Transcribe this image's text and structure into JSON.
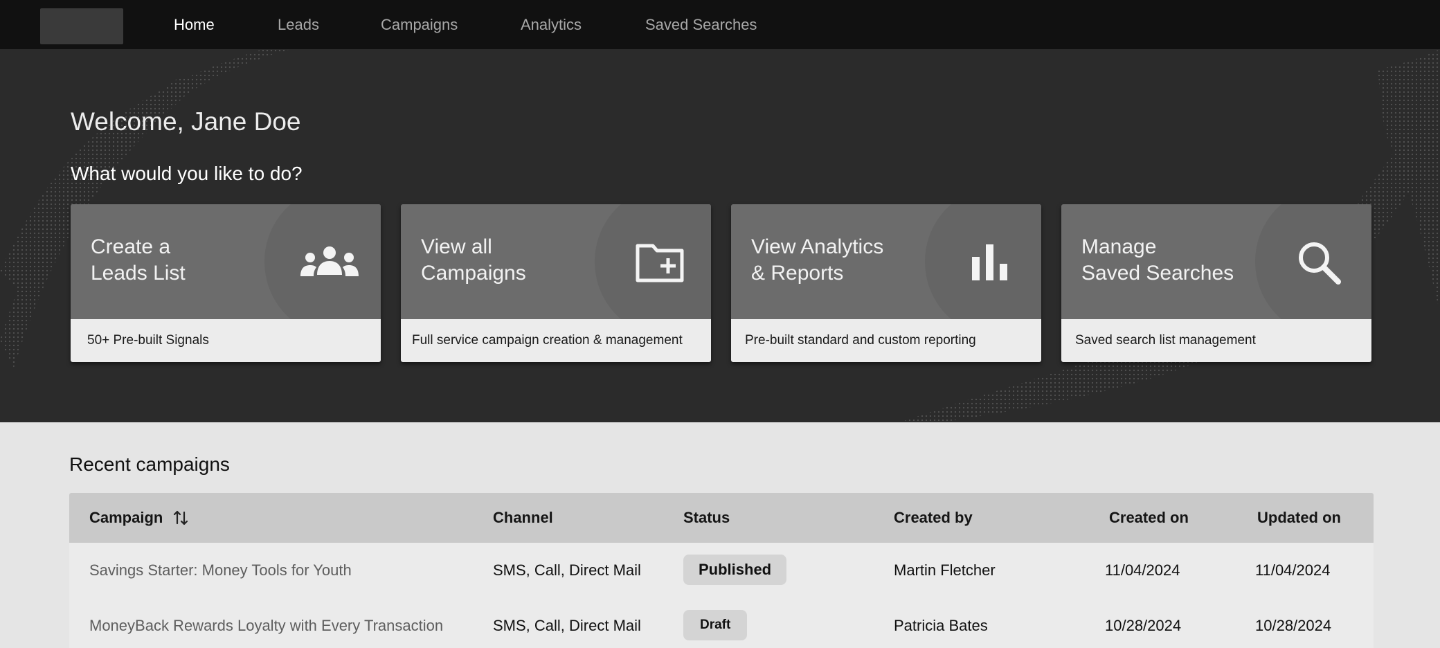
{
  "nav": {
    "items": [
      {
        "label": "Home",
        "active": true
      },
      {
        "label": "Leads",
        "active": false
      },
      {
        "label": "Campaigns",
        "active": false
      },
      {
        "label": "Analytics",
        "active": false
      },
      {
        "label": "Saved Searches",
        "active": false
      }
    ]
  },
  "hero": {
    "welcome": "Welcome, Jane Doe",
    "prompt": "What would you like to do?"
  },
  "cards": [
    {
      "title_line1": "Create a",
      "title_line2": "Leads List",
      "description": "50+ Pre-built Signals",
      "icon": "users-group-icon"
    },
    {
      "title_line1": "View all",
      "title_line2": "Campaigns",
      "description": "Full service campaign creation & management",
      "icon": "folder-add-icon"
    },
    {
      "title_line1": "View Analytics",
      "title_line2": "& Reports",
      "description": "Pre-built standard and custom reporting",
      "icon": "bar-chart-icon"
    },
    {
      "title_line1": "Manage",
      "title_line2": "Saved Searches",
      "description": "Saved search list management",
      "icon": "search-icon"
    }
  ],
  "recent": {
    "title": "Recent campaigns",
    "columns": [
      "Campaign",
      "Channel",
      "Status",
      "Created by",
      "Created on",
      "Updated on"
    ],
    "rows": [
      {
        "campaign": "Savings Starter: Money Tools for Youth",
        "channel": "SMS, Call, Direct Mail",
        "status": "Published",
        "created_by": "Martin Fletcher",
        "created_on": "11/04/2024",
        "updated_on": "11/04/2024"
      },
      {
        "campaign": "MoneyBack Rewards Loyalty with Every Transaction",
        "channel": "SMS, Call, Direct Mail",
        "status": "Draft",
        "created_by": "Patricia Bates",
        "created_on": "10/28/2024",
        "updated_on": "10/28/2024"
      }
    ]
  },
  "colors": {
    "nav_bg": "#111111",
    "hero_bg": "#2b2b2b",
    "card_top": "#6c6c6c",
    "card_bottom": "#ececec",
    "table_header": "#c9c9c9",
    "badge_bg": "#d4d4d4"
  }
}
